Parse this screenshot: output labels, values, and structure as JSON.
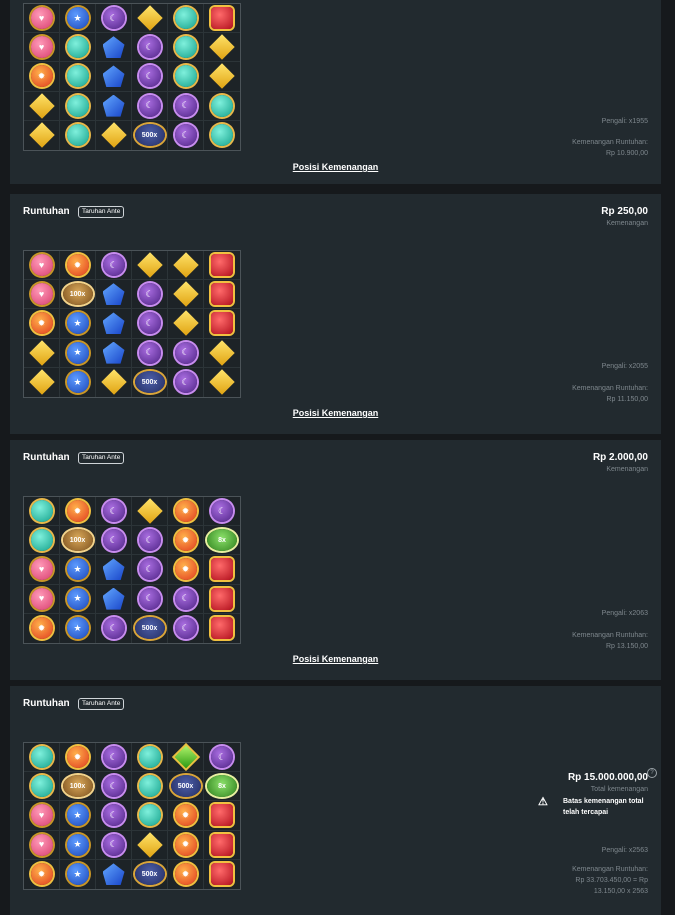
{
  "labels": {
    "cascade": "Runtuhan",
    "ante": "Taruhan Ante",
    "win_positions": "Posisi Kemenangan",
    "win": "Kemenangan",
    "total_win": "Total kemenangan",
    "limit": "Batas kemenangan total telah tercapai"
  },
  "icons": {
    "heart": "heart-gem-icon",
    "star": "star-gem-icon",
    "moon": "moon-gem-icon",
    "gold": "gold-gem-icon",
    "teal": "teal-gem-icon",
    "sun": "sun-gem-icon",
    "blue": "blue-gem-icon",
    "red": "red-gem-icon",
    "green": "green-gem-icon",
    "warning": "warning-icon",
    "info": "info-icon"
  },
  "cards": [
    {
      "has_header": false,
      "amount": "",
      "multiplier": "Pengali: x1955",
      "cascade_win_label": "Kemenangan Runtuhan:",
      "cascade_win_value": "Rp 10.900,00",
      "grid": [
        [
          "heart",
          "star",
          "moon",
          "gold",
          "teal",
          "red"
        ],
        [
          "heart",
          "teal",
          "blue",
          "moon",
          "teal",
          "gold"
        ],
        [
          "sun",
          "teal",
          "blue",
          "moon",
          "teal",
          "gold"
        ],
        [
          "gold",
          "teal",
          "blue",
          "moon",
          "moon",
          "teal"
        ],
        [
          "gold",
          "teal",
          "gold",
          "x500",
          "moon",
          "teal"
        ]
      ]
    },
    {
      "has_header": true,
      "amount": "Rp 250,00",
      "multiplier": "Pengali: x2055",
      "cascade_win_label": "Kemenangan Runtuhan:",
      "cascade_win_value": "Rp 11.150,00",
      "grid": [
        [
          "heart",
          "sun",
          "moon",
          "gold",
          "gold",
          "red"
        ],
        [
          "heart",
          "x100",
          "blue",
          "moon",
          "gold",
          "red"
        ],
        [
          "sun",
          "star",
          "blue",
          "moon",
          "gold",
          "red"
        ],
        [
          "gold",
          "star",
          "blue",
          "moon",
          "moon",
          "gold"
        ],
        [
          "gold",
          "star",
          "gold",
          "x500",
          "moon",
          "gold"
        ]
      ]
    },
    {
      "has_header": true,
      "amount": "Rp 2.000,00",
      "multiplier": "Pengali: x2063",
      "cascade_win_label": "Kemenangan Runtuhan:",
      "cascade_win_value": "Rp 13.150,00",
      "grid": [
        [
          "teal",
          "sun",
          "moon",
          "gold",
          "sun",
          "moon"
        ],
        [
          "teal",
          "x100",
          "moon",
          "moon",
          "sun",
          "x8"
        ],
        [
          "heart",
          "star",
          "blue",
          "moon",
          "sun",
          "red"
        ],
        [
          "heart",
          "star",
          "blue",
          "moon",
          "moon",
          "red"
        ],
        [
          "sun",
          "star",
          "moon",
          "x500",
          "moon",
          "red"
        ]
      ]
    },
    {
      "has_header": true,
      "amount": "Rp 15.000.000,00",
      "multiplier": "Pengali: x2563",
      "cascade_win_label": "Kemenangan Runtuhan:",
      "cascade_win_value": "Rp 33.703.450,00 = Rp",
      "cascade_win_value2": "13.150,00 x 2563",
      "grid": [
        [
          "teal",
          "sun",
          "moon",
          "teal",
          "green",
          "moon"
        ],
        [
          "teal",
          "x100",
          "moon",
          "teal",
          "x500",
          "x8"
        ],
        [
          "heart",
          "star",
          "moon",
          "teal",
          "sun",
          "red"
        ],
        [
          "heart",
          "star",
          "moon",
          "gold",
          "sun",
          "red"
        ],
        [
          "sun",
          "star",
          "blue",
          "x500",
          "sun",
          "red"
        ]
      ]
    }
  ]
}
